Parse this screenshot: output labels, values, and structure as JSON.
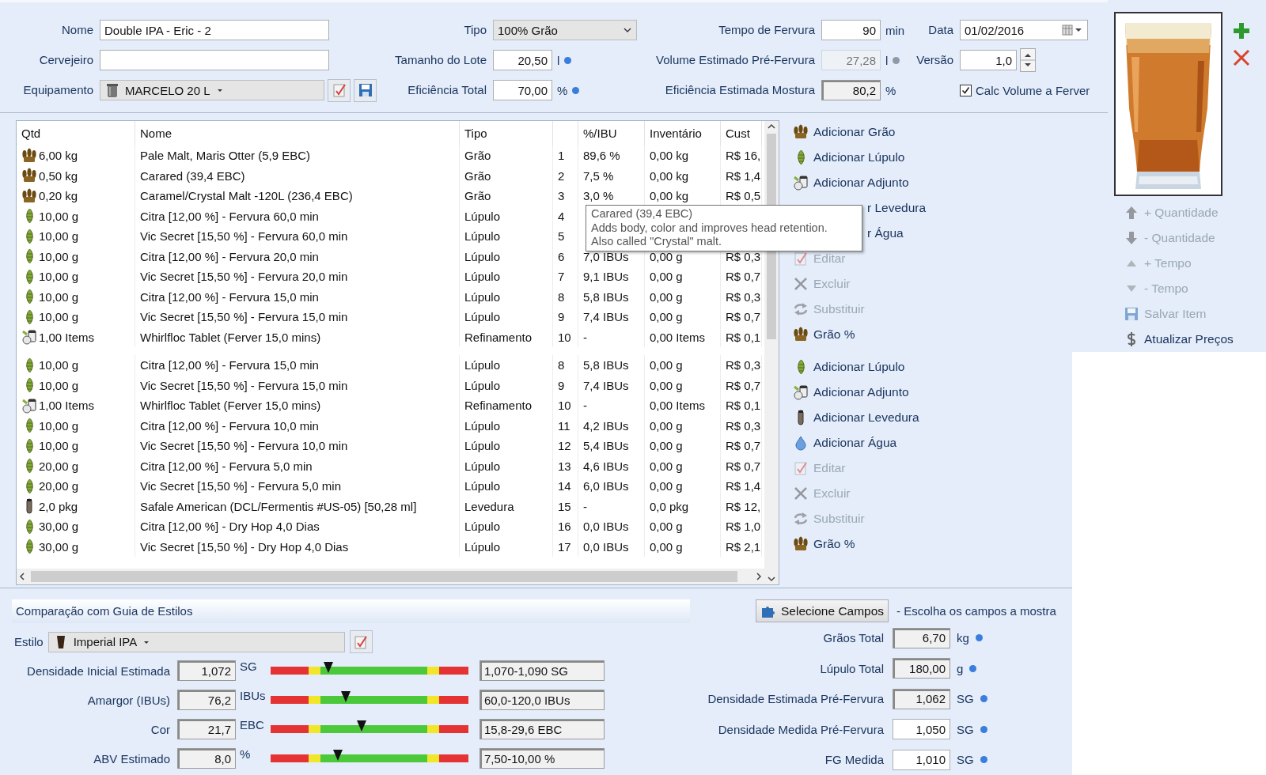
{
  "recipe_form": {
    "columns": [
      {
        "fields": [
          {
            "label": "Nome",
            "kind": "text",
            "value": "Double IPA - Eric - 2"
          },
          {
            "label": "Cervejeiro",
            "kind": "text"
          },
          {
            "label": "Equipamento",
            "kind": "dropdown",
            "value": "MARCELO 20 L",
            "buttons": [
              {
                "kind": "edit"
              },
              {
                "kind": "save"
              }
            ]
          }
        ]
      },
      {
        "fields": [
          {
            "label": "Tipo",
            "kind": "select",
            "value": "100% Grão"
          },
          {
            "label": "Tamanho do Lote",
            "kind": "number",
            "value": "20,50",
            "unit": "l",
            "color": "#3b7ddd"
          },
          {
            "label": "Eficiência Total",
            "kind": "number",
            "value": "70,00",
            "unit": "%",
            "color": "#3b7ddd"
          }
        ]
      },
      {
        "fields": [
          {
            "label": "Tempo de Fervura",
            "kind": "number",
            "value": "90",
            "unit": "min"
          },
          {
            "label": "Volume Estimado Pré-Fervura",
            "kind": "readonly",
            "value": "27,28",
            "unit": "l",
            "color": "#8c9aab"
          },
          {
            "label": "Eficiência Estimada Mostura",
            "kind": "sunken",
            "value": "80,2",
            "unit": "%"
          }
        ]
      },
      {
        "fields": [
          {
            "label": "Data",
            "kind": "date",
            "value": "01/02/2016"
          },
          {
            "label": "Versão",
            "kind": "spinner",
            "value": "1,0"
          },
          {
            "kind": "checkbox",
            "text": "Calc Volume a Ferver",
            "checked": true
          }
        ]
      }
    ]
  },
  "ingredients": {
    "columns": [
      {
        "label": "Qtd"
      },
      {
        "label": "Nome"
      },
      {
        "label": "Tipo"
      },
      {},
      {
        "label": "%/IBU"
      },
      {
        "label": "Inventário"
      },
      {
        "label": "Cust"
      }
    ],
    "row_groups": [
      [
        {
          "kind": "grain",
          "qty": "6,00 kg",
          "name": "Pale Malt, Maris Otter (5,9 EBC)",
          "type": "Grão",
          "num": "1",
          "ibu": "89,6 %",
          "inventory": "0,00 kg",
          "cost": "R$ 16,"
        },
        {
          "kind": "grain",
          "qty": "0,50 kg",
          "name": "Carared (39,4 EBC)",
          "type": "Grão",
          "num": "2",
          "ibu": "7,5 %",
          "inventory": "0,00 kg",
          "cost": "R$ 1,4"
        },
        {
          "kind": "grain",
          "qty": "0,20 kg",
          "name": "Caramel/Crystal Malt -120L (236,4 EBC)",
          "type": "Grão",
          "num": "3",
          "ibu": "3,0 %",
          "inventory": "0,00 kg",
          "cost": "R$ 0,5"
        },
        {
          "kind": "hop",
          "qty": "10,00 g",
          "name": "Citra [12,00 %] - Fervura 60,0 min",
          "type": "Lúpulo",
          "num": "4"
        },
        {
          "kind": "hop",
          "qty": "10,00 g",
          "name": "Vic Secret [15,50 %] - Fervura 60,0 min",
          "type": "Lúpulo",
          "num": "5"
        },
        {
          "kind": "hop",
          "qty": "10,00 g",
          "name": "Citra [12,00 %] - Fervura 20,0 min",
          "type": "Lúpulo",
          "num": "6",
          "ibu": "7,0 IBUs",
          "inventory": "0,00 g",
          "cost": "R$ 0,3"
        },
        {
          "kind": "hop",
          "qty": "10,00 g",
          "name": "Vic Secret [15,50 %] - Fervura 20,0 min",
          "type": "Lúpulo",
          "num": "7",
          "ibu": "9,1 IBUs",
          "inventory": "0,00 g",
          "cost": "R$ 0,7"
        },
        {
          "kind": "hop",
          "qty": "10,00 g",
          "name": "Citra [12,00 %] - Fervura 15,0 min",
          "type": "Lúpulo",
          "num": "8",
          "ibu": "5,8 IBUs",
          "inventory": "0,00 g",
          "cost": "R$ 0,3"
        },
        {
          "kind": "hop",
          "qty": "10,00 g",
          "name": "Vic Secret [15,50 %] - Fervura 15,0 min",
          "type": "Lúpulo",
          "num": "9",
          "ibu": "7,4 IBUs",
          "inventory": "0,00 g",
          "cost": "R$ 0,7"
        },
        {
          "kind": "adjunct",
          "qty": "1,00 Items",
          "name": "Whirlfloc Tablet (Ferver 15,0 mins)",
          "type": "Refinamento",
          "num": "10",
          "ibu": "-",
          "inventory": "0,00 Items",
          "cost": "R$ 0,1"
        }
      ],
      [
        {
          "kind": "hop",
          "qty": "10,00 g",
          "name": "Citra [12,00 %] - Fervura 15,0 min",
          "type": "Lúpulo",
          "num": "8",
          "ibu": "5,8 IBUs",
          "inventory": "0,00 g",
          "cost": "R$ 0,3"
        },
        {
          "kind": "hop",
          "qty": "10,00 g",
          "name": "Vic Secret [15,50 %] - Fervura 15,0 min",
          "type": "Lúpulo",
          "num": "9",
          "ibu": "7,4 IBUs",
          "inventory": "0,00 g",
          "cost": "R$ 0,7"
        },
        {
          "kind": "adjunct",
          "qty": "1,00 Items",
          "name": "Whirlfloc Tablet (Ferver 15,0 mins)",
          "type": "Refinamento",
          "num": "10",
          "ibu": "-",
          "inventory": "0,00 Items",
          "cost": "R$ 0,1"
        },
        {
          "kind": "hop",
          "qty": "10,00 g",
          "name": "Citra [12,00 %] - Fervura 10,0 min",
          "type": "Lúpulo",
          "num": "11",
          "ibu": "4,2 IBUs",
          "inventory": "0,00 g",
          "cost": "R$ 0,3"
        },
        {
          "kind": "hop",
          "qty": "10,00 g",
          "name": "Vic Secret [15,50 %] - Fervura 10,0 min",
          "type": "Lúpulo",
          "num": "12",
          "ibu": "5,4 IBUs",
          "inventory": "0,00 g",
          "cost": "R$ 0,7"
        },
        {
          "kind": "hop",
          "qty": "20,00 g",
          "name": "Citra [12,00 %] - Fervura 5,0 min",
          "type": "Lúpulo",
          "num": "13",
          "ibu": "4,6 IBUs",
          "inventory": "0,00 g",
          "cost": "R$ 0,7"
        },
        {
          "kind": "hop",
          "qty": "20,00 g",
          "name": "Vic Secret [15,50 %] - Fervura 5,0 min",
          "type": "Lúpulo",
          "num": "14",
          "ibu": "6,0 IBUs",
          "inventory": "0,00 g",
          "cost": "R$ 1,4"
        },
        {
          "kind": "yeast",
          "qty": "2,0 pkg",
          "name": "Safale American  (DCL/Fermentis #US-05) [50,28 ml]",
          "type": "Levedura",
          "num": "15",
          "ibu": "-",
          "inventory": "0,0 pkg",
          "cost": "R$ 12,"
        },
        {
          "kind": "hop",
          "qty": "30,00 g",
          "name": "Citra [12,00 %] - Dry Hop 4,0 Dias",
          "type": "Lúpulo",
          "num": "16",
          "ibu": "0,0 IBUs",
          "inventory": "0,00 g",
          "cost": "R$ 1,0"
        },
        {
          "kind": "hop",
          "qty": "30,00 g",
          "name": "Vic Secret [15,50 %] - Dry Hop 4,0 Dias",
          "type": "Lúpulo",
          "num": "17",
          "ibu": "0,0 IBUs",
          "inventory": "0,00 g",
          "cost": "R$ 2,1"
        }
      ]
    ],
    "tooltip": {
      "lines": [
        "Carared (39,4 EBC)",
        "Adds body, color and improves head retention.",
        "Also called \"Crystal\" malt."
      ]
    }
  },
  "actions": [
    [
      {
        "kind": "grain",
        "label": "Adicionar Grão",
        "disabled": false
      },
      {
        "kind": "hop",
        "label": "Adicionar Lúpulo",
        "disabled": false
      },
      {
        "kind": "adjunct",
        "label": "Adicionar Adjunto",
        "disabled": false
      },
      {
        "kind": "covered",
        "label": "r Levedura",
        "disabled": false
      },
      {
        "kind": "covered",
        "label": "r Água",
        "disabled": false
      },
      {
        "kind": "edit",
        "label": "Editar",
        "disabled": true
      },
      {
        "kind": "delete",
        "label": "Excluir",
        "disabled": true
      },
      {
        "kind": "replace",
        "label": "Substituir",
        "disabled": true
      },
      {
        "kind": "grain",
        "label": "Grão %",
        "disabled": false
      }
    ],
    [
      {
        "kind": "hop",
        "label": "Adicionar Lúpulo",
        "disabled": false
      },
      {
        "kind": "adjunct",
        "label": "Adicionar Adjunto",
        "disabled": false
      },
      {
        "kind": "yeast",
        "label": "Adicionar Levedura",
        "disabled": false
      },
      {
        "kind": "water",
        "label": "Adicionar Água",
        "disabled": false
      },
      {
        "kind": "edit",
        "label": "Editar",
        "disabled": true
      },
      {
        "kind": "delete",
        "label": "Excluir",
        "disabled": true
      },
      {
        "kind": "replace",
        "label": "Substituir",
        "disabled": true
      },
      {
        "kind": "grain",
        "label": "Grão %",
        "disabled": false
      }
    ]
  ],
  "side_panel": {
    "actions": [
      {
        "kind": "up",
        "label": "+ Quantidade",
        "disabled": true
      },
      {
        "kind": "down",
        "label": "- Quantidade",
        "disabled": true
      },
      {
        "kind": "tri-up",
        "label": "+ Tempo",
        "disabled": true
      },
      {
        "kind": "tri-down",
        "label": "- Tempo",
        "disabled": true
      },
      {
        "kind": "save",
        "label": "Salvar Item",
        "disabled": true
      },
      {
        "kind": "dollar",
        "label": "Atualizar Preços",
        "disabled": false
      }
    ]
  },
  "style_guide": {
    "title": "Comparação com Guia de Estilos",
    "style": {
      "label": "Estilo",
      "value": "Imperial IPA"
    },
    "rows": [
      {
        "label": "Densidade Inicial Estimada",
        "value": "1,072",
        "unit": "SG",
        "level": 0.29,
        "range": "1,070-1,090 SG"
      },
      {
        "label": "Amargor (IBUs)",
        "value": "76,2",
        "unit": "IBUs",
        "level": 0.38,
        "range": "60,0-120,0 IBUs"
      },
      {
        "label": "Cor",
        "value": "21,7",
        "unit": "EBC",
        "level": 0.46,
        "range": "15,8-29,6 EBC"
      },
      {
        "label": "ABV Estimado",
        "value": "8,0",
        "unit": "%",
        "level": 0.34,
        "range": "7,50-10,00 %"
      }
    ]
  },
  "summary": {
    "button": "Selecione Campos",
    "hint": "- Escolha os campos a mostra",
    "fields": [
      {
        "label": "Grãos Total",
        "kind": "readonly",
        "value": "6,70",
        "unit": "kg",
        "color": "#3b7ddd"
      },
      {
        "label": "Lúpulo Total",
        "kind": "readonly",
        "value": "180,00",
        "unit": "g",
        "color": "#3b7ddd"
      },
      {
        "label": "Densidade Estimada Pré-Fervura",
        "kind": "readonly",
        "value": "1,062",
        "unit": "SG",
        "color": "#3b7ddd"
      },
      {
        "label": "Densidade Medida Pré-Fervura",
        "kind": "input",
        "value": "1,050",
        "unit": "SG",
        "color": "#3b7ddd"
      },
      {
        "label": "FG Medida",
        "kind": "input",
        "value": "1,010",
        "unit": "SG",
        "color": "#3b7ddd"
      }
    ]
  }
}
